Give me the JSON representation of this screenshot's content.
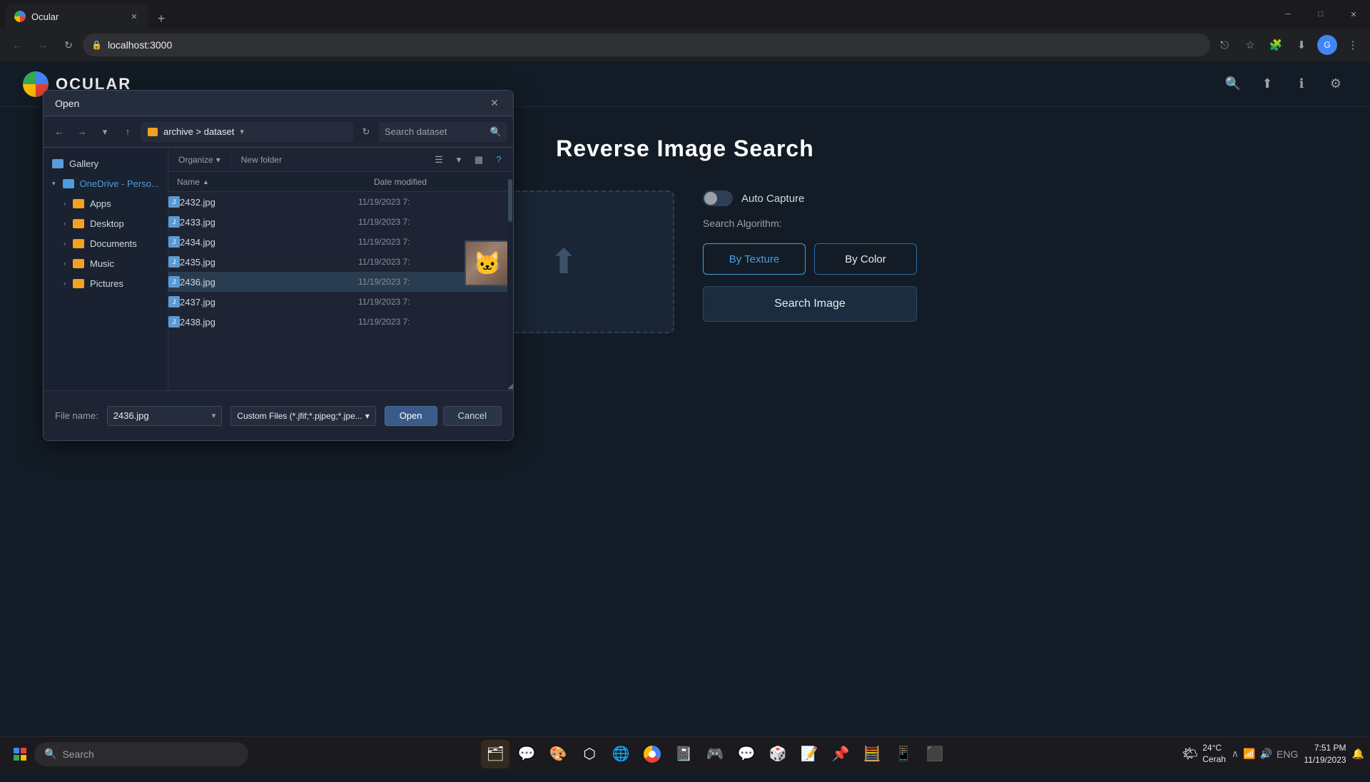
{
  "browser": {
    "tab_title": "Ocular",
    "url": "localhost:3000",
    "new_tab_icon": "+",
    "win_minimize": "─",
    "win_restore": "□",
    "win_close": "✕"
  },
  "nav": {
    "back": "←",
    "forward": "→",
    "refresh": "↻",
    "up": "↑",
    "lock_icon": "🔒"
  },
  "app": {
    "logo_text": "OCULAR",
    "page_title": "Reverse Image Search",
    "auto_capture_label": "Auto Capture",
    "search_algorithm_label": "Search Algorithm:",
    "by_texture_label": "By Texture",
    "by_color_label": "By Color",
    "search_image_label": "Search Image"
  },
  "dialog": {
    "title": "Open",
    "close_icon": "✕",
    "breadcrumb_path": "archive  >  dataset",
    "search_placeholder": "Search dataset",
    "organize_label": "Organize",
    "new_folder_label": "New folder",
    "col_name": "Name",
    "col_date_modified": "Date modified",
    "files": [
      {
        "name": "2432.jpg",
        "date": "11/19/2023 7:",
        "selected": false
      },
      {
        "name": "2433.jpg",
        "date": "11/19/2023 7:",
        "selected": false
      },
      {
        "name": "2434.jpg",
        "date": "11/19/2023 7:",
        "selected": false
      },
      {
        "name": "2435.jpg",
        "date": "11/19/2023 7:",
        "selected": false
      },
      {
        "name": "2436.jpg",
        "date": "11/19/2023 7:",
        "selected": true
      },
      {
        "name": "2437.jpg",
        "date": "11/19/2023 7:",
        "selected": false
      },
      {
        "name": "2438.jpg",
        "date": "11/19/2023 7:",
        "selected": false
      }
    ],
    "sidebar_items": [
      {
        "icon": "gallery",
        "label": "Gallery",
        "level": 1,
        "expanded": false
      },
      {
        "icon": "onedrive",
        "label": "OneDrive - Perso...",
        "level": 1,
        "expanded": true
      },
      {
        "icon": "folder",
        "label": "Apps",
        "level": 2,
        "expanded": false
      },
      {
        "icon": "folder",
        "label": "Desktop",
        "level": 2,
        "expanded": false
      },
      {
        "icon": "folder",
        "label": "Documents",
        "level": 2,
        "expanded": false
      },
      {
        "icon": "folder",
        "label": "Music",
        "level": 2,
        "expanded": false
      },
      {
        "icon": "folder",
        "label": "Pictures",
        "level": 2,
        "expanded": false
      }
    ],
    "filename_label": "File name:",
    "filename_value": "2436.jpg",
    "filetype_value": "Custom Files (*.jfif;*.pjpeg;*.jpe...",
    "btn_open": "Open",
    "btn_cancel": "Cancel"
  },
  "taskbar": {
    "search_placeholder": "Search",
    "time": "7:51 PM",
    "date": "11/19/2023",
    "weather": "24°C",
    "weather_desc": "Cerah"
  }
}
